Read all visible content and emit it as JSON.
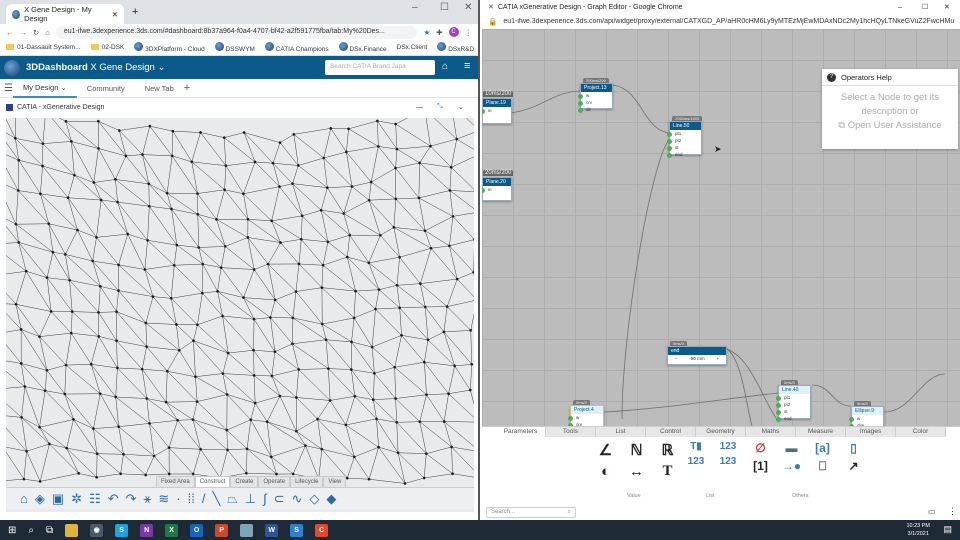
{
  "left_window": {
    "tab_title": "X Gene Design - My Design",
    "url": "eu1-ifwe.3dexperience.3ds.com/#dashboard:8b37a964-f0a4-4707-bf42-a2f591775fba/tab:My%20Des...",
    "profile_initial": "C",
    "bookmarks": [
      "01-Dassault System...",
      "02-DSK",
      "3DXPlatform - Cloud",
      "DSSWYM",
      "CATIA Champions",
      "DSx.Finance",
      "DSx.Client",
      "DSxR&D"
    ],
    "dashboard_brand": "3DDashboard",
    "dashboard_name": "X Gene Design",
    "search_placeholder": "Search CATIA Brand Japa",
    "tabs": [
      "My Design",
      "Community",
      "New Tab"
    ],
    "widget_title": "CATIA - xGenerative Design",
    "toolbar_tabs": [
      "Fixed Area",
      "Construct",
      "Create",
      "Operate",
      "Lifecycle",
      "View"
    ]
  },
  "right_window": {
    "title": "CATIA xGenerative Design - Graph Editor - Google Chrome",
    "url": "eu1-ifwe.3dexperience.3ds.com/api/widget/proxy/external/CATXGD_AP/aHR0cHM6Ly9yMTEzMjEwMDAxNDc2My1hcHQyLTNkeGVuZ2FwcHMuM...",
    "help": {
      "title": "Operators Help",
      "line1": "Select a Node to get its",
      "line2": "description or",
      "link": "Open User Assistance"
    },
    "nodes": [
      {
        "time": "10ms/200",
        "name": "Plane.19",
        "ports": [
          "in"
        ]
      },
      {
        "time": "200ms/200",
        "name": "Project.13",
        "ports": [
          "w",
          "crv",
          "dir"
        ]
      },
      {
        "time": "2050ms/1000",
        "name": "Line.50",
        "ports": [
          "pt1",
          "pt2",
          "st",
          "end"
        ]
      },
      {
        "time": "20ms/200",
        "name": "Plane.20",
        "ports": [
          "in"
        ]
      },
      {
        "time": "0ms/0",
        "name": "end",
        "value": "-80 mm"
      },
      {
        "time": "0ms/0",
        "name": "Line.40",
        "ports": [
          "pt1",
          "pt2",
          "st",
          "end"
        ]
      },
      {
        "time": "0ms/0",
        "name": "Project.4",
        "ports": [
          "w",
          "crv"
        ]
      },
      {
        "time": "0ms/0",
        "name": "Ellipse.9",
        "ports": [
          "w",
          "dim"
        ]
      }
    ],
    "palette_tabs": [
      "Parameters",
      "Tools",
      "List",
      "Control",
      "Geometry",
      "Maths",
      "Measure",
      "Images",
      "Color"
    ],
    "palette_groups": [
      "Value",
      "List",
      "Others"
    ],
    "search_placeholder": "Search..."
  },
  "taskbar": {
    "time": "10:23 PM",
    "date": "3/1/2021"
  }
}
